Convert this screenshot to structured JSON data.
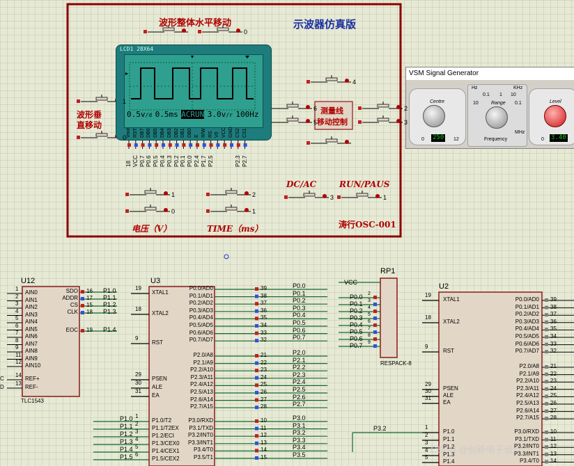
{
  "oscilloscope": {
    "title": "示波器仿真版",
    "h_move_label": "波形整体水平移动",
    "v_move_label_1": "波形垂",
    "v_move_label_2": "直移动",
    "measure_label_1": "测量线",
    "measure_label_2": "移动控制",
    "dcac_label": "DC/AC",
    "runpause_label": "RUN/PAUS",
    "voltage_label": "电压（V）",
    "time_label": "TIME（ms）",
    "author_label": "涛行OSC-001",
    "lcd": {
      "model": "LCD1 28X64",
      "readout": [
        "0.5v",
        "0.5ms",
        "AC",
        "RUN",
        "3.0v",
        "100Hz"
      ],
      "readout_suffix": [
        "/d",
        "",
        "",
        "",
        "/r",
        ""
      ],
      "pins": [
        "Vout",
        "RST",
        "DB7",
        "DB6",
        "DB5",
        "DB4",
        "DB3",
        "DB2",
        "DB1",
        "DB0",
        "E",
        "R/W",
        "RS",
        "V0",
        "VCC",
        "GND",
        "CS2",
        "CS1"
      ],
      "pin_nets": [
        "18",
        "VCC",
        "P0.7",
        "P0.6",
        "P0.5",
        "P0.4",
        "P0.3",
        "P0.2",
        "P0.1",
        "P0.0",
        "P2.4",
        "P1.7",
        "P2.5",
        "",
        "",
        "",
        "P2.3",
        "P2.7"
      ],
      "pin_nums": [
        "18",
        "17",
        "16",
        "15",
        "14",
        "13",
        "12",
        "11",
        "10",
        "9",
        "8",
        "7",
        "6",
        "5",
        "4",
        "3",
        "2",
        "1"
      ]
    },
    "buttons": {
      "h_left": "0",
      "h_right": "0",
      "v_a": "1",
      "v_b": "0",
      "meas": [
        "4",
        "6",
        "5",
        "2",
        "3"
      ],
      "vol_a": "1",
      "vol_b": "0",
      "time_a": "2",
      "time_b": "1",
      "dcac_num": "3",
      "runpause_num": "1"
    }
  },
  "signal_generator": {
    "title": "VSM Signal Generator",
    "centre": {
      "label": "Centre",
      "scale": [
        "0",
        "1",
        "2",
        "3",
        "4",
        "5",
        "6",
        "7",
        "8",
        "9",
        "10",
        "11",
        "12"
      ],
      "led": "250"
    },
    "range": {
      "label": "Range",
      "labels": [
        "0.1",
        "1",
        "10",
        "0.1",
        "1",
        "10"
      ],
      "unit_hz": "Hz",
      "unit_khz": "KHz",
      "unit_mhz": "MHz",
      "caption": "Frequency"
    },
    "level": {
      "label": "Level",
      "scale": [
        "0",
        "1",
        "2",
        "3",
        "4",
        "5",
        "6",
        "7",
        "8",
        "9",
        "10",
        "11",
        "12"
      ],
      "led": "3.40"
    }
  },
  "u12": {
    "ref": "U12",
    "part": "TLC1543",
    "left_pins": [
      {
        "num": "1",
        "name": "AIN0"
      },
      {
        "num": "2",
        "name": "AIN1"
      },
      {
        "num": "3",
        "name": "AIN2"
      },
      {
        "num": "4",
        "name": "AIN3"
      },
      {
        "num": "5",
        "name": "AIN4"
      },
      {
        "num": "6",
        "name": "AIN5"
      },
      {
        "num": "7",
        "name": "AIN6"
      },
      {
        "num": "8",
        "name": "AIN7"
      },
      {
        "num": "9",
        "name": "AIN8"
      },
      {
        "num": "11",
        "name": "AIN9"
      },
      {
        "num": "12",
        "name": "AIN10"
      },
      {
        "num": "14",
        "name": "REF+",
        "net": "C"
      },
      {
        "num": "13",
        "name": "REF-",
        "net": "D"
      }
    ],
    "right_pins": [
      {
        "num": "16",
        "name": "SDO",
        "net": "P1.0"
      },
      {
        "num": "17",
        "name": "ADDR",
        "net": "P1.1"
      },
      {
        "num": "15",
        "name": "CS",
        "net": "P1.2"
      },
      {
        "num": "18",
        "name": "CLK",
        "net": "P1.3"
      },
      {
        "num": "19",
        "name": "EOC",
        "net": "P1.4"
      }
    ]
  },
  "u3": {
    "ref": "U3",
    "left_pins": [
      {
        "num": "19",
        "name": "XTAL1"
      },
      {
        "num": "18",
        "name": "XTAL2"
      },
      {
        "num": "9",
        "name": "RST"
      },
      {
        "num": "29",
        "name": "PSEN"
      },
      {
        "num": "30",
        "name": "ALE"
      },
      {
        "num": "31",
        "name": "EA"
      },
      {
        "num": "1",
        "name": "P1.0/T2",
        "net": "P1.0"
      },
      {
        "num": "2",
        "name": "P1.1/T2EX",
        "net": "P1.1"
      },
      {
        "num": "3",
        "name": "P1.2/ECI",
        "net": "P1.2"
      },
      {
        "num": "4",
        "name": "P1.3/CEX0",
        "net": "P1.3"
      },
      {
        "num": "5",
        "name": "P1.4/CEX1",
        "net": "P1.4"
      },
      {
        "num": "6",
        "name": "P1.5/CEX2",
        "net": "P1.5"
      }
    ],
    "right_pins": [
      {
        "num": "39",
        "name": "P0.0/AD0",
        "net": "P0.0"
      },
      {
        "num": "38",
        "name": "P0.1/AD1",
        "net": "P0.1"
      },
      {
        "num": "37",
        "name": "P0.2/AD2",
        "net": "P0.2"
      },
      {
        "num": "36",
        "name": "P0.3/AD3",
        "net": "P0.3"
      },
      {
        "num": "35",
        "name": "P0.4/AD4",
        "net": "P0.4"
      },
      {
        "num": "34",
        "name": "P0.5/AD5",
        "net": "P0.5"
      },
      {
        "num": "33",
        "name": "P0.6/AD6",
        "net": "P0.6"
      },
      {
        "num": "32",
        "name": "P0.7/AD7",
        "net": "P0.7"
      },
      {
        "num": "21",
        "name": "P2.0/A8",
        "net": "P2.0"
      },
      {
        "num": "22",
        "name": "P2.1/A9",
        "net": "P2.1"
      },
      {
        "num": "23",
        "name": "P2.2/A10",
        "net": "P2.2"
      },
      {
        "num": "24",
        "name": "P2.3/A11",
        "net": "P2.3"
      },
      {
        "num": "25",
        "name": "P2.4/A12",
        "net": "P2.4"
      },
      {
        "num": "26",
        "name": "P2.5/A13",
        "net": "P2.5"
      },
      {
        "num": "27",
        "name": "P2.6/A14",
        "net": "P2.6"
      },
      {
        "num": "28",
        "name": "P2.7/A15",
        "net": "P2.7"
      },
      {
        "num": "10",
        "name": "P3.0/RXD",
        "net": "P3.0"
      },
      {
        "num": "11",
        "name": "P3.1/TXD",
        "net": "P3.1"
      },
      {
        "num": "12",
        "name": "P3.2/INT0",
        "net": "P3.2"
      },
      {
        "num": "13",
        "name": "P3.3/INT1",
        "net": "P3.3"
      },
      {
        "num": "14",
        "name": "P3.4/T0",
        "net": "P3.4"
      },
      {
        "num": "15",
        "name": "P3.5/T1",
        "net": "P3.5"
      }
    ]
  },
  "rp1": {
    "ref": "RP1",
    "part": "RESPACK-8",
    "vcc": "VCC",
    "pins": [
      {
        "num": "2",
        "net": "P0.0"
      },
      {
        "num": "3",
        "net": "P0.1"
      },
      {
        "num": "4",
        "net": "P0.2"
      },
      {
        "num": "5",
        "net": "P0.3"
      },
      {
        "num": "6",
        "net": "P0.4"
      },
      {
        "num": "7",
        "net": "P0.5"
      },
      {
        "num": "8",
        "net": "P0.6"
      },
      {
        "num": "9",
        "net": "P0.7"
      }
    ]
  },
  "u2": {
    "ref": "U2",
    "left_pins": [
      {
        "num": "19",
        "name": "XTAL1"
      },
      {
        "num": "18",
        "name": "XTAL2"
      },
      {
        "num": "9",
        "name": "RST"
      },
      {
        "num": "29",
        "name": "PSEN"
      },
      {
        "num": "30",
        "name": "ALE"
      },
      {
        "num": "31",
        "name": "EA"
      },
      {
        "num": "1",
        "name": "P1.0"
      },
      {
        "num": "2",
        "name": "P1.1"
      },
      {
        "num": "3",
        "name": "P1.2"
      },
      {
        "num": "4",
        "name": "P1.3"
      },
      {
        "num": "5",
        "name": "P1.4"
      }
    ],
    "right_pins": [
      {
        "num": "39",
        "name": "P0.0/AD0"
      },
      {
        "num": "38",
        "name": "P0.1/AD1"
      },
      {
        "num": "37",
        "name": "P0.2/AD2"
      },
      {
        "num": "36",
        "name": "P0.3/AD3"
      },
      {
        "num": "35",
        "name": "P0.4/AD4"
      },
      {
        "num": "34",
        "name": "P0.5/AD5"
      },
      {
        "num": "33",
        "name": "P0.6/AD6"
      },
      {
        "num": "32",
        "name": "P0.7/AD7"
      },
      {
        "num": "21",
        "name": "P2.0/A8"
      },
      {
        "num": "22",
        "name": "P2.1/A9"
      },
      {
        "num": "23",
        "name": "P2.2/A10"
      },
      {
        "num": "24",
        "name": "P2.3/A11"
      },
      {
        "num": "25",
        "name": "P2.4/A12"
      },
      {
        "num": "26",
        "name": "P2.5/A13"
      },
      {
        "num": "27",
        "name": "P2.6/A14"
      },
      {
        "num": "28",
        "name": "P2.7/A15"
      },
      {
        "num": "10",
        "name": "P3.0/RXD"
      },
      {
        "num": "11",
        "name": "P3.1/TXD"
      },
      {
        "num": "12",
        "name": "P3.2/INT0"
      },
      {
        "num": "13",
        "name": "P3.3/INT1"
      },
      {
        "num": "14",
        "name": "P3.4/T0"
      }
    ],
    "p32_net": "P3.2"
  },
  "watermark": "CSDN @创新电子设计",
  "colors": {
    "component_border": "#8b1a1a",
    "component_fill": "#e2d6c6",
    "frame": "#8b0000",
    "wire": "#0e6b2a",
    "text_red": "#b00000"
  }
}
